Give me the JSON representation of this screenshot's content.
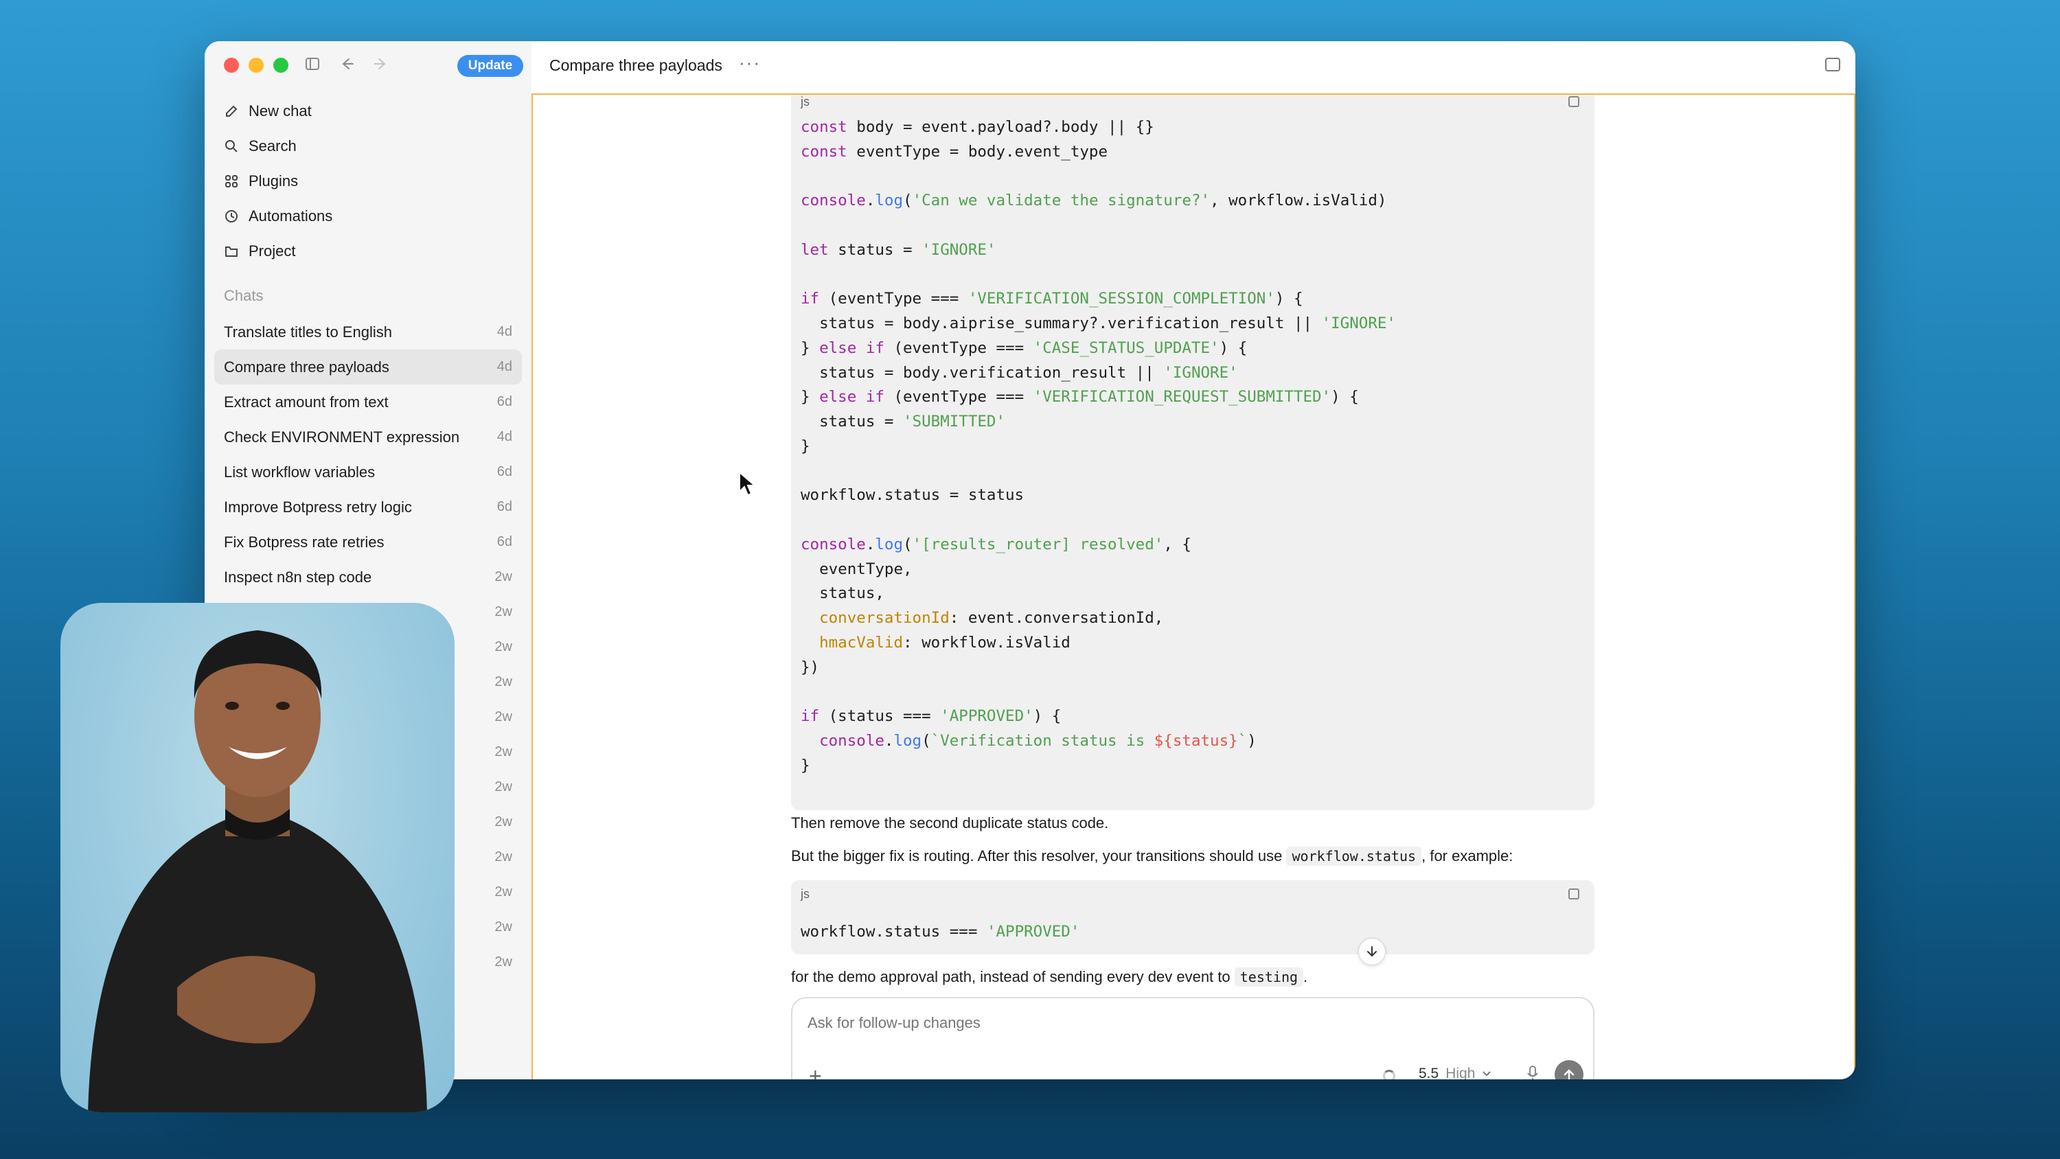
{
  "window": {
    "update_label": "Update"
  },
  "sidebar": {
    "nav": [
      {
        "label": "New chat",
        "icon": "edit-icon"
      },
      {
        "label": "Search",
        "icon": "search-icon"
      },
      {
        "label": "Plugins",
        "icon": "plugins-icon"
      },
      {
        "label": "Automations",
        "icon": "clock-icon"
      },
      {
        "label": "Project",
        "icon": "folder-icon"
      }
    ],
    "section_label": "Chats",
    "chats": [
      {
        "title": "Translate titles to English",
        "age": "4d"
      },
      {
        "title": "Compare three payloads",
        "age": "4d"
      },
      {
        "title": "Extract amount from text",
        "age": "6d"
      },
      {
        "title": "Check ENVIRONMENT expression",
        "age": "4d"
      },
      {
        "title": "List workflow variables",
        "age": "6d"
      },
      {
        "title": "Improve Botpress retry logic",
        "age": "6d"
      },
      {
        "title": "Fix Botpress rate retries",
        "age": "6d"
      },
      {
        "title": "Inspect n8n step code",
        "age": "2w"
      },
      {
        "title": "",
        "age": "2w"
      },
      {
        "title": "",
        "age": "2w"
      },
      {
        "title": "",
        "age": "2w"
      },
      {
        "title": "",
        "age": "2w"
      },
      {
        "title": "",
        "age": "2w"
      },
      {
        "title": "",
        "age": "2w"
      },
      {
        "title": "",
        "age": "2w"
      },
      {
        "title": "",
        "age": "2w"
      },
      {
        "title": "",
        "age": "2w"
      },
      {
        "title": "",
        "age": "2w"
      },
      {
        "title": "",
        "age": "2w"
      }
    ]
  },
  "header": {
    "title": "Compare three payloads",
    "more": "···"
  },
  "code1": {
    "lang": "js",
    "lines": [
      "const body = event.payload?.body || {}",
      "const eventType = body.event_type",
      "",
      "console.log('Can we validate the signature?', workflow.isValid)",
      "",
      "let status = 'IGNORE'",
      "",
      "if (eventType === 'VERIFICATION_SESSION_COMPLETION') {",
      "  status = body.aiprise_summary?.verification_result || 'IGNORE'",
      "} else if (eventType === 'CASE_STATUS_UPDATE') {",
      "  status = body.verification_result || 'IGNORE'",
      "} else if (eventType === 'VERIFICATION_REQUEST_SUBMITTED') {",
      "  status = 'SUBMITTED'",
      "}",
      "",
      "workflow.status = status",
      "",
      "console.log('[results_router] resolved', {",
      "  eventType,",
      "  status,",
      "  conversationId: event.conversationId,",
      "  hmacValid: workflow.isValid",
      "})",
      "",
      "if (status === 'APPROVED') {",
      "  console.log(`Verification status is ${status}`)",
      "}"
    ]
  },
  "para1": "Then remove the second duplicate status code.",
  "para2": {
    "before": "But the bigger fix is routing. After this resolver, your transitions should use ",
    "code": "workflow.status",
    "after": ", for example:"
  },
  "code2": {
    "lang": "js",
    "line": "workflow.status === 'APPROVED'"
  },
  "para3": {
    "before": "for the demo approval path, instead of sending every dev event to ",
    "code": "testing",
    "after": "."
  },
  "composer": {
    "placeholder": "Ask for follow-up changes",
    "model": "5.5",
    "effort": "High"
  }
}
